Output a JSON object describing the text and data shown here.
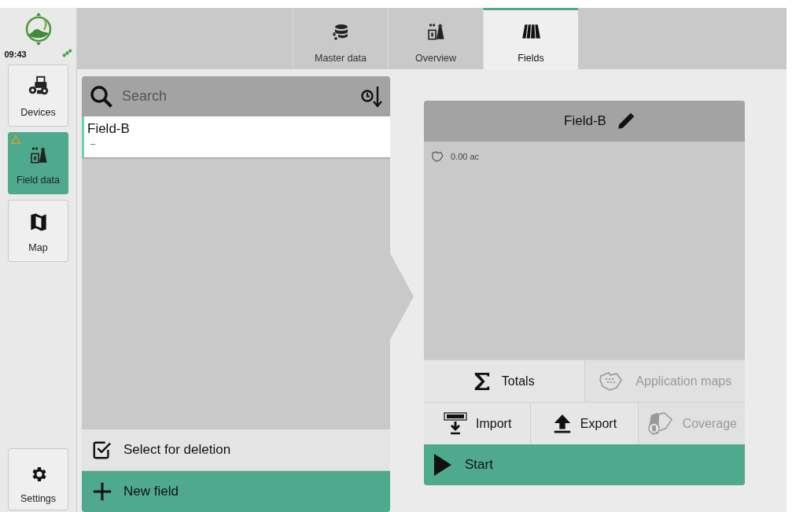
{
  "sidebar": {
    "clock": "09:43",
    "items": [
      {
        "label": "Devices",
        "kind": "devices",
        "selected": false,
        "warning": false
      },
      {
        "label": "Field data",
        "kind": "fielddata",
        "selected": true,
        "warning": true
      },
      {
        "label": "Map",
        "kind": "map",
        "selected": false,
        "warning": false
      }
    ],
    "settings": {
      "label": "Settings",
      "kind": "settings",
      "selected": false,
      "warning": false
    }
  },
  "tabs": [
    {
      "label": "Master data",
      "kind": "masterdata",
      "selected": false
    },
    {
      "label": "Overview",
      "kind": "fielddata",
      "selected": false
    },
    {
      "label": "Fields",
      "kind": "fields",
      "selected": true
    }
  ],
  "field_list": {
    "search": {
      "placeholder": "Search"
    },
    "items": [
      {
        "name": "Field-B",
        "detail": "–",
        "selected": true
      }
    ],
    "actions": [
      {
        "label": "Select for deletion",
        "kind": "select"
      },
      {
        "label": "New field",
        "kind": "add"
      }
    ]
  },
  "field_card": {
    "title": "Field-B",
    "area": "0.00 ac",
    "button_rows": [
      [
        {
          "label": "Totals",
          "kind": "totals",
          "disabled": false
        },
        {
          "label": "Application maps",
          "kind": "appmaps",
          "disabled": true
        }
      ],
      [
        {
          "label": "Import",
          "kind": "import",
          "disabled": false
        },
        {
          "label": "Export",
          "kind": "export",
          "disabled": false
        },
        {
          "label": "Coverage",
          "kind": "coverage",
          "disabled": true
        }
      ]
    ],
    "start": {
      "label": "Start"
    }
  }
}
